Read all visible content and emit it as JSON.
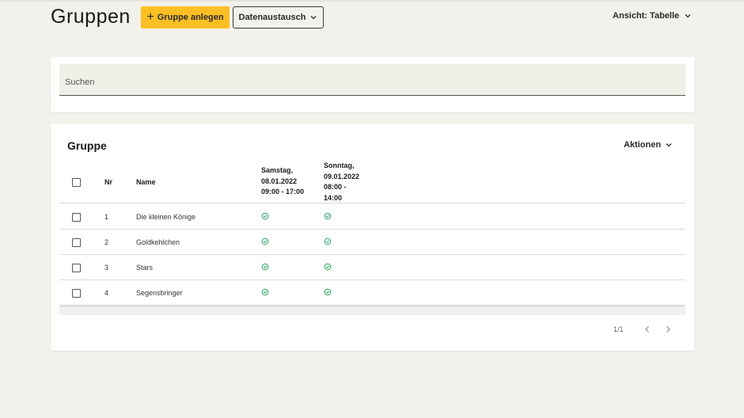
{
  "header": {
    "title": "Gruppen",
    "add_button": "Gruppe anlegen",
    "exchange_button": "Datenaustausch",
    "view_toggle": "Ansicht: Tabelle"
  },
  "search": {
    "placeholder": "Suchen",
    "value": ""
  },
  "table": {
    "title": "Gruppe",
    "actions_label": "Aktionen",
    "columns": {
      "nr": "Nr",
      "name": "Name",
      "day1": [
        "Samstag,",
        "08.01.2022",
        "09:00 - 17:00"
      ],
      "day2": [
        "Sonntag,",
        "09.01.2022",
        "08:00 -",
        "14:00"
      ]
    },
    "rows": [
      {
        "nr": "1",
        "name": "Die kleinen Könige",
        "day1": "check-circle-icon",
        "day2": "check-circle-icon"
      },
      {
        "nr": "2",
        "name": "Goldkehlchen",
        "day1": "check-circle-icon",
        "day2": "check-circle-icon"
      },
      {
        "nr": "3",
        "name": "Stars",
        "day1": "check-circle-icon",
        "day2": "check-circle-icon"
      },
      {
        "nr": "4",
        "name": "Segensbringer",
        "day1": "check-circle-icon",
        "day2": "check-circle-icon"
      }
    ],
    "pagination": "1/1"
  },
  "colors": {
    "background": "#f2f1eb",
    "accent": "#fbbf24",
    "success": "#22a35a"
  }
}
